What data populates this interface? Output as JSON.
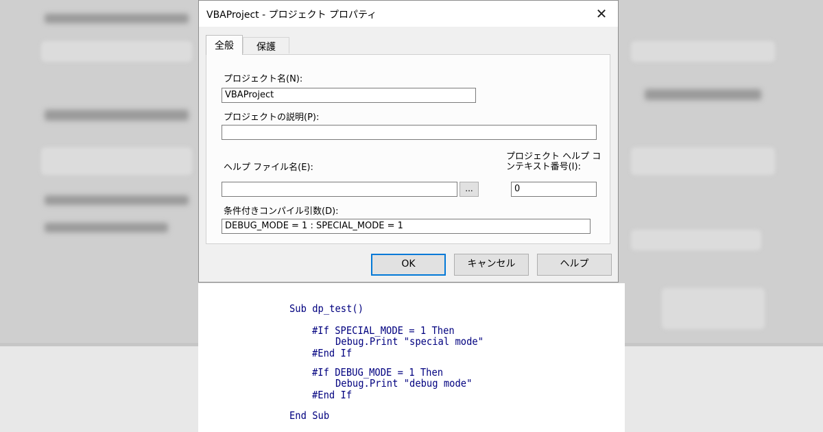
{
  "dialog": {
    "title": "VBAProject - プロジェクト プロパティ",
    "close_glyph": "✕",
    "tabs": [
      {
        "label": "全般"
      },
      {
        "label": "保護"
      }
    ],
    "project_name_label": "プロジェクト名(N):",
    "project_name_value": "VBAProject",
    "description_label": "プロジェクトの説明(P):",
    "description_value": "",
    "help_file_label": "ヘルプ ファイル名(E):",
    "help_file_value": "",
    "browse_label": "...",
    "help_context_label_line1": "プロジェクト ヘルプ コ",
    "help_context_label_line2": "ンテキスト番号(I):",
    "help_context_value": "0",
    "conditional_label": "条件付きコンパイル引数(D):",
    "conditional_value": "DEBUG_MODE = 1 : SPECIAL_MODE = 1",
    "buttons": {
      "ok": "OK",
      "cancel": "キャンセル",
      "help": "ヘルプ"
    }
  },
  "code": {
    "lines": [
      "Sub dp_test()",
      "#If SPECIAL_MODE = 1 Then",
      "Debug.Print \"special mode\"",
      "#End If",
      "#If DEBUG_MODE = 1 Then",
      "Debug.Print \"debug mode\"",
      "#End If",
      "End Sub"
    ]
  },
  "colors": {
    "focus_border": "#0078d7",
    "code_text": "#00007f"
  }
}
